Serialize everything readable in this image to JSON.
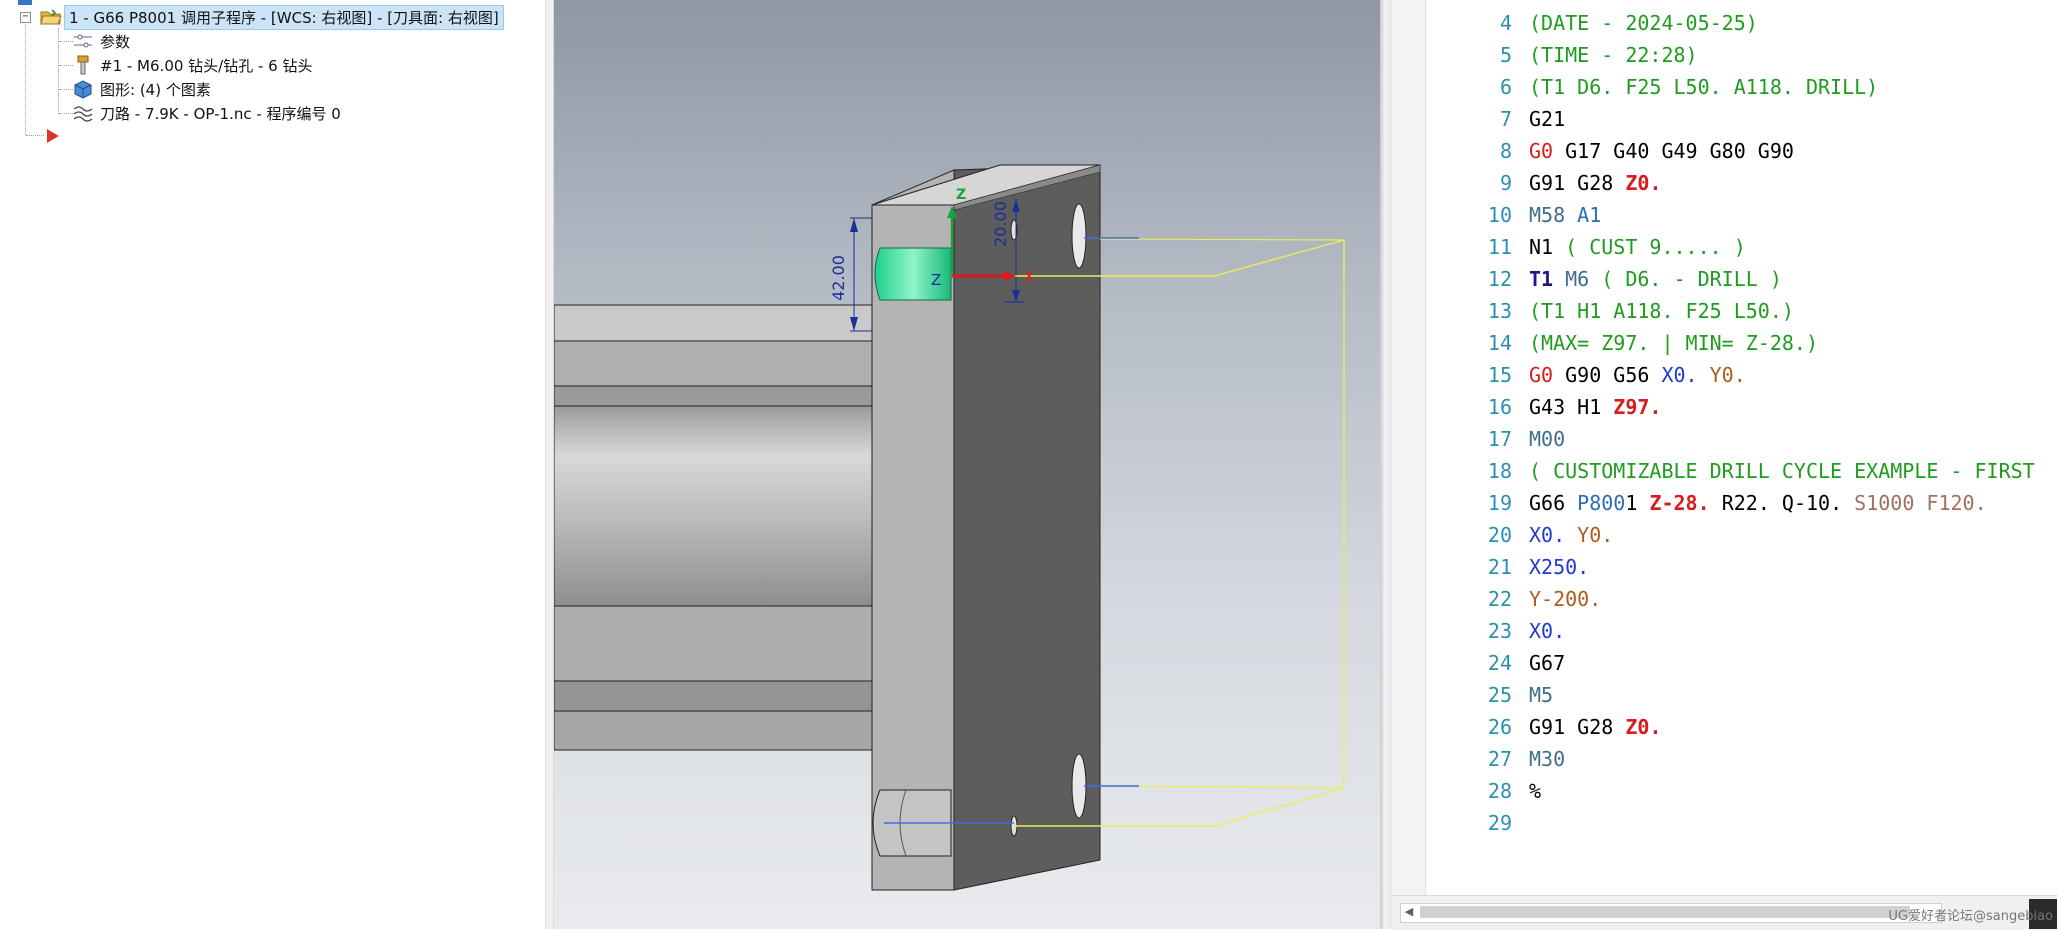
{
  "tree": {
    "root_label": "1 - G66 P8001 调用子程序 - [WCS: 右视图] - [刀具面: 右视图]",
    "children": [
      {
        "label": "参数",
        "icon": "parameters-icon"
      },
      {
        "label": "#1 - M6.00 钻头/钻孔 - 6 钻头",
        "icon": "drill-tool-icon"
      },
      {
        "label": "图形: (4) 个图素",
        "icon": "geometry-cube-icon"
      },
      {
        "label": "刀路 - 7.9K - OP-1.nc - 程序编号 0",
        "icon": "toolpath-icon"
      }
    ],
    "insert_arrow_icon": "insert-arrow-icon"
  },
  "viewport": {
    "dimension_vertical": "42.00",
    "dimension_top": "20.00",
    "axis_x": "X",
    "axis_z": "Z",
    "axis_z_small": "Z",
    "colors": {
      "part": "#a9a9a9",
      "selected_face": "#1fdc96",
      "toolpath": "#ecec5a",
      "dimension": "#1b2e9a"
    }
  },
  "editor": {
    "lines": [
      {
        "n": "4",
        "tokens": [
          {
            "c": "t-comment",
            "t": "(DATE - 2024-05-25)"
          }
        ]
      },
      {
        "n": "5",
        "tokens": [
          {
            "c": "t-comment",
            "t": "(TIME - 22:28)"
          }
        ]
      },
      {
        "n": "6",
        "tokens": [
          {
            "c": "t-comment",
            "t": "(T1 D6. F25 L50. A118. DRILL)"
          }
        ]
      },
      {
        "n": "7",
        "tokens": [
          {
            "c": "t-plain",
            "t": "G21"
          }
        ]
      },
      {
        "n": "8",
        "tokens": [
          {
            "c": "t-gred",
            "t": "G0"
          },
          {
            "c": "t-plain",
            "t": " G17 G40 G49 G80 G90"
          }
        ]
      },
      {
        "n": "9",
        "tokens": [
          {
            "c": "t-plain",
            "t": "G91 G28 "
          },
          {
            "c": "t-zbold",
            "t": "Z0."
          }
        ]
      },
      {
        "n": "10",
        "tokens": [
          {
            "c": "t-mteal",
            "t": "M58"
          },
          {
            "c": "t-pblue",
            "t": " A1"
          }
        ]
      },
      {
        "n": "11",
        "tokens": [
          {
            "c": "t-plain",
            "t": "N1 "
          },
          {
            "c": "t-comment",
            "t": "( CUST 9..... )"
          }
        ]
      },
      {
        "n": "12",
        "tokens": [
          {
            "c": "t-tbold",
            "t": "T1"
          },
          {
            "c": "t-mteal",
            "t": " M6"
          },
          {
            "c": "t-comment",
            "t": " ( D6. - DRILL )"
          }
        ]
      },
      {
        "n": "13",
        "tokens": [
          {
            "c": "t-comment",
            "t": "(T1 H1 A118. F25 L50.)"
          }
        ]
      },
      {
        "n": "14",
        "tokens": [
          {
            "c": "t-comment",
            "t": "(MAX= Z97. | MIN= Z-28.)"
          }
        ]
      },
      {
        "n": "15",
        "tokens": [
          {
            "c": "t-gred",
            "t": "G0"
          },
          {
            "c": "t-plain",
            "t": " G90 G56 "
          },
          {
            "c": "t-xblue",
            "t": "X0."
          },
          {
            "c": "t-plain",
            "t": " "
          },
          {
            "c": "t-ybrown",
            "t": "Y0."
          }
        ]
      },
      {
        "n": "16",
        "tokens": [
          {
            "c": "t-plain",
            "t": "G43 H1 "
          },
          {
            "c": "t-zbold",
            "t": "Z97."
          }
        ]
      },
      {
        "n": "17",
        "tokens": [
          {
            "c": "t-mteal",
            "t": "M00"
          }
        ]
      },
      {
        "n": "18",
        "tokens": [
          {
            "c": "t-comment",
            "t": "( CUSTOMIZABLE DRILL CYCLE EXAMPLE - FIRST"
          }
        ]
      },
      {
        "n": "19",
        "tokens": [
          {
            "c": "t-plain",
            "t": "G66 "
          },
          {
            "c": "t-pblue",
            "t": "P800"
          },
          {
            "c": "t-plain",
            "t": "1 "
          },
          {
            "c": "t-zbold",
            "t": "Z-28."
          },
          {
            "c": "t-plain",
            "t": " R22. Q-10. "
          },
          {
            "c": "t-sbrown",
            "t": "S1000 F120."
          }
        ]
      },
      {
        "n": "20",
        "tokens": [
          {
            "c": "t-xblue",
            "t": "X0."
          },
          {
            "c": "t-plain",
            "t": " "
          },
          {
            "c": "t-ybrown",
            "t": "Y0."
          }
        ]
      },
      {
        "n": "21",
        "tokens": [
          {
            "c": "t-xblue",
            "t": "X250."
          }
        ]
      },
      {
        "n": "22",
        "tokens": [
          {
            "c": "t-ybrown",
            "t": "Y-200."
          }
        ]
      },
      {
        "n": "23",
        "tokens": [
          {
            "c": "t-xblue",
            "t": "X0."
          }
        ]
      },
      {
        "n": "24",
        "tokens": [
          {
            "c": "t-plain",
            "t": "G67"
          }
        ]
      },
      {
        "n": "25",
        "tokens": [
          {
            "c": "t-mteal",
            "t": "M5"
          }
        ]
      },
      {
        "n": "26",
        "tokens": [
          {
            "c": "t-plain",
            "t": "G91 G28 "
          },
          {
            "c": "t-zbold",
            "t": "Z0."
          }
        ]
      },
      {
        "n": "27",
        "tokens": [
          {
            "c": "t-mteal",
            "t": "M30"
          }
        ]
      },
      {
        "n": "28",
        "tokens": [
          {
            "c": "t-plain",
            "t": "%"
          }
        ]
      },
      {
        "n": "29",
        "tokens": []
      }
    ],
    "watermark": "UG爱好者论坛@sangebiao"
  }
}
